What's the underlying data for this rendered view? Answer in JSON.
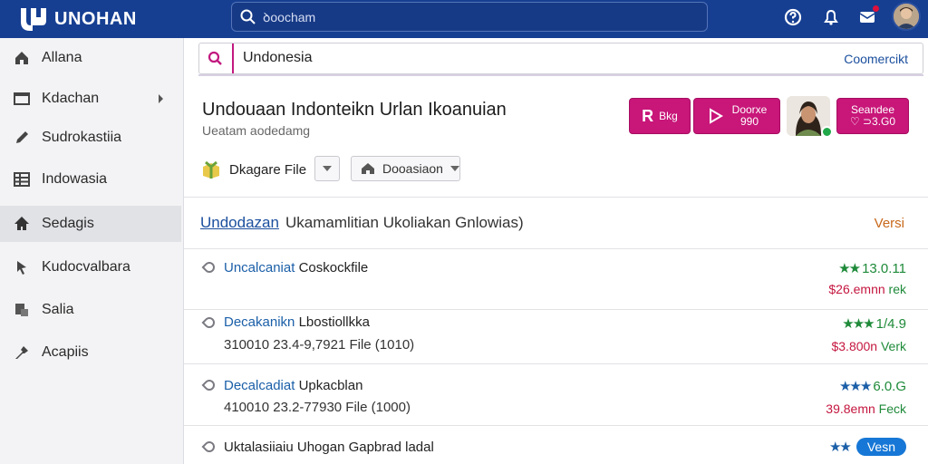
{
  "topbar": {
    "logo_text": "UNOHAN",
    "search_placeholder": "ꝺoocham",
    "icons": [
      "logo-icon",
      "search-icon",
      "help-icon",
      "bell-icon",
      "inbox-icon",
      "avatar"
    ]
  },
  "sidebar": {
    "items": [
      {
        "label": "Allana",
        "icon": "home-icon"
      },
      {
        "label": "Kdachan",
        "icon": "window-icon",
        "chevron": true
      },
      {
        "label": "Sudrokastiia",
        "icon": "pen-icon"
      },
      {
        "label": "Indowasia",
        "icon": "grid-icon"
      },
      {
        "label": "Sedagis",
        "icon": "home-filled-icon",
        "active": true
      },
      {
        "label": "Kudocvalbara",
        "icon": "cursor-icon"
      },
      {
        "label": "Salia",
        "icon": "doc-icon"
      },
      {
        "label": "Acapiis",
        "icon": "tool-icon"
      }
    ]
  },
  "search": {
    "value": "Undonesia",
    "link": "Coomercikt"
  },
  "header": {
    "title": "Undouaan Indonteikn Urlan Ikoanuian",
    "subtitle": "Ueatam aodedamg",
    "btn1_icon_label": "R",
    "btn1_label": "Bkg",
    "btn2_line1": "Doorxe",
    "btn2_line2": "990",
    "btn3_line1": "Seandee",
    "btn3_line2": "♡ ⊃3.G0",
    "file_label": "Dkagare File",
    "dropdown_label": "Dooasiaon"
  },
  "section": {
    "link": "Undodazan",
    "text": "Ukamamlitian Ukoliakan Gnlowias)",
    "right": "Versi"
  },
  "rows": [
    {
      "hl": "Uncalcaniat",
      "name": "Coskockfile",
      "meta": "",
      "rating": "13.0.11",
      "stars": "★★",
      "price": "$26.emnn",
      "price_tag": "rek",
      "price_color": "#c4163f"
    },
    {
      "hl": "Decakanikn",
      "name": "Lbostiollkka",
      "meta": "310010 23.4-9,7921 File (1010)",
      "rating": "1/4.9",
      "stars": "★★★",
      "price": "$3.800n",
      "price_tag": "Verk",
      "price_color": "#c4163f"
    },
    {
      "hl": "Decalcadiat",
      "name": "Upkacblan",
      "meta": "410010 23.2-77930 File (1000)",
      "rating": "6.0.G",
      "stars": "★★★",
      "price": "39.8emn",
      "price_tag": "Feck",
      "price_color": "#c4163f"
    },
    {
      "hl": "",
      "name": "Uktalasiiaiu Uhogan Gapbrad ladal",
      "meta": "",
      "rating": "",
      "stars": "★★",
      "pill": "Vesn",
      "price": "",
      "price_tag": ""
    }
  ],
  "colors": {
    "topbar": "#163f92",
    "accent": "#c81679",
    "link": "#1b4f9e",
    "rating": "#1e8a39",
    "price": "#c4163f"
  }
}
